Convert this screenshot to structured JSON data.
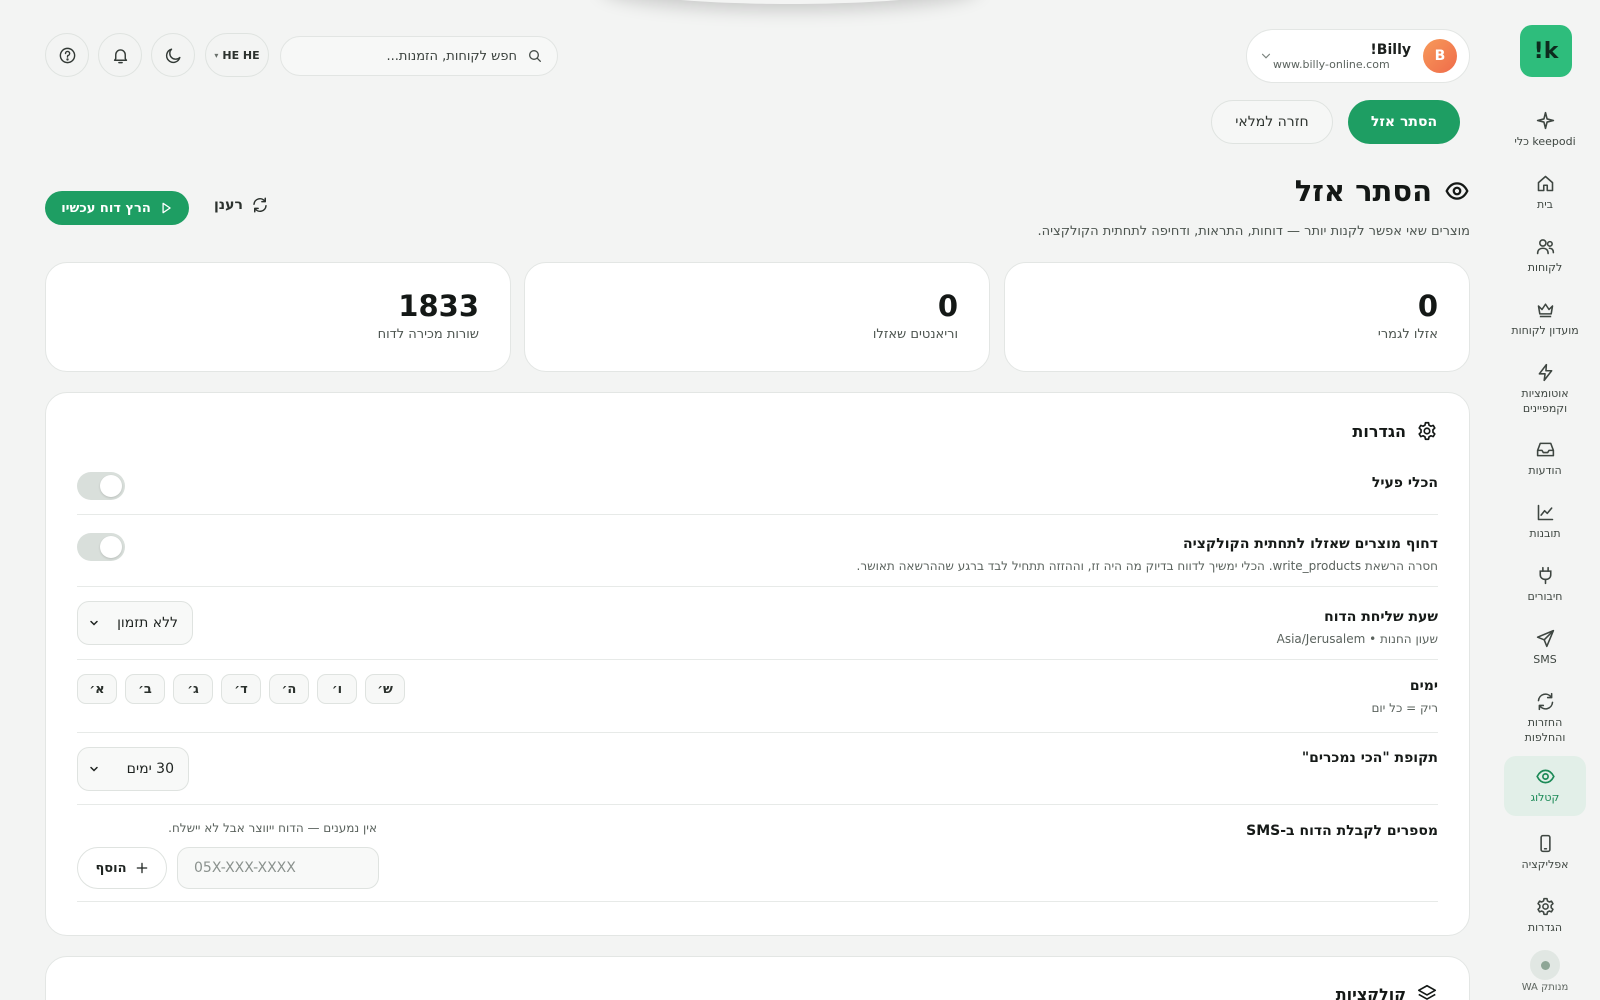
{
  "app": {
    "logo_text": "!k"
  },
  "sidebar": {
    "items": [
      {
        "label": "keepodi כלי",
        "icon": "sparkle-icon"
      },
      {
        "label": "בית",
        "icon": "home-icon"
      },
      {
        "label": "לקוחות",
        "icon": "users-icon"
      },
      {
        "label": "מועדון לקוחות",
        "icon": "crown-icon"
      },
      {
        "label": "אוטומציות וקמפיינים",
        "icon": "lightning-icon"
      },
      {
        "label": "הודעות",
        "icon": "inbox-icon"
      },
      {
        "label": "תובנות",
        "icon": "chart-icon"
      },
      {
        "label": "חיבורים",
        "icon": "plug-icon"
      },
      {
        "label": "SMS",
        "icon": "send-icon"
      },
      {
        "label": "החזרות והחלפות",
        "icon": "refresh-icon"
      },
      {
        "label": "קטלוג",
        "icon": "eye-icon",
        "active": true
      },
      {
        "label": "אפליקציה",
        "icon": "phone-icon"
      },
      {
        "label": "הגדרות",
        "icon": "gear-icon"
      }
    ],
    "wa_status": "WA מנותק"
  },
  "store": {
    "avatar_letter": "B",
    "name": "Billy!",
    "url": "www.billy-online.com"
  },
  "search": {
    "placeholder": "חפש לקוחות, הזמנות..."
  },
  "lang": {
    "label": "HE HE"
  },
  "actions": {
    "primary": "הסתר אזל",
    "secondary": "חזרה למלאי"
  },
  "page": {
    "title": "הסתר אזל",
    "subtitle": "מוצרים שאי אפשר לקנות יותר — דוחות, התראות, ודחיפה לתחתית הקולקציה.",
    "refresh_label": "רענן",
    "run_label": "הרץ דוח עכשיו"
  },
  "stats": [
    {
      "value": "0",
      "label": "אזלו לגמרי"
    },
    {
      "value": "0",
      "label": "וריאנטים שאזלו"
    },
    {
      "value": "1833",
      "label": "שורות מכירה לדוח"
    }
  ],
  "settings": {
    "title": "הגדרות",
    "tool_active": {
      "title": "הכלי פעיל",
      "enabled": false
    },
    "push_bottom": {
      "title": "דחוף מוצרים שאזלו לתחתית הקולקציה",
      "desc": "חסרה הרשאת write_products. הכלי ימשיך לדווח בדיוק מה היה זז, וההזזה תתחיל לבד ברגע שההרשאה תאושר.",
      "enabled": false
    },
    "send_time": {
      "title": "שעת שליחת הדוח",
      "desc": "שעון החנות • Asia/Jerusalem",
      "value": "ללא תזמון"
    },
    "days": {
      "title": "ימים",
      "desc": "ריק = כל יום",
      "options": [
        "א׳",
        "ב׳",
        "ג׳",
        "ד׳",
        "ה׳",
        "ו׳",
        "ש׳"
      ]
    },
    "period": {
      "title": "תקופת \"הכי נמכרים\"",
      "value": "30 ימים"
    },
    "sms": {
      "title": "מספרים לקבלת הדוח ב-SMS",
      "note": "אין נמענים — הדוח ייווצר אבל לא יישלח.",
      "placeholder": "05X-XXX-XXXX",
      "add_label": "הוסף"
    }
  },
  "collections": {
    "title": "קולקציות"
  },
  "colors": {
    "accent": "#1e9e63",
    "logo": "#2ebd7c",
    "background": "#f3f4f3"
  }
}
